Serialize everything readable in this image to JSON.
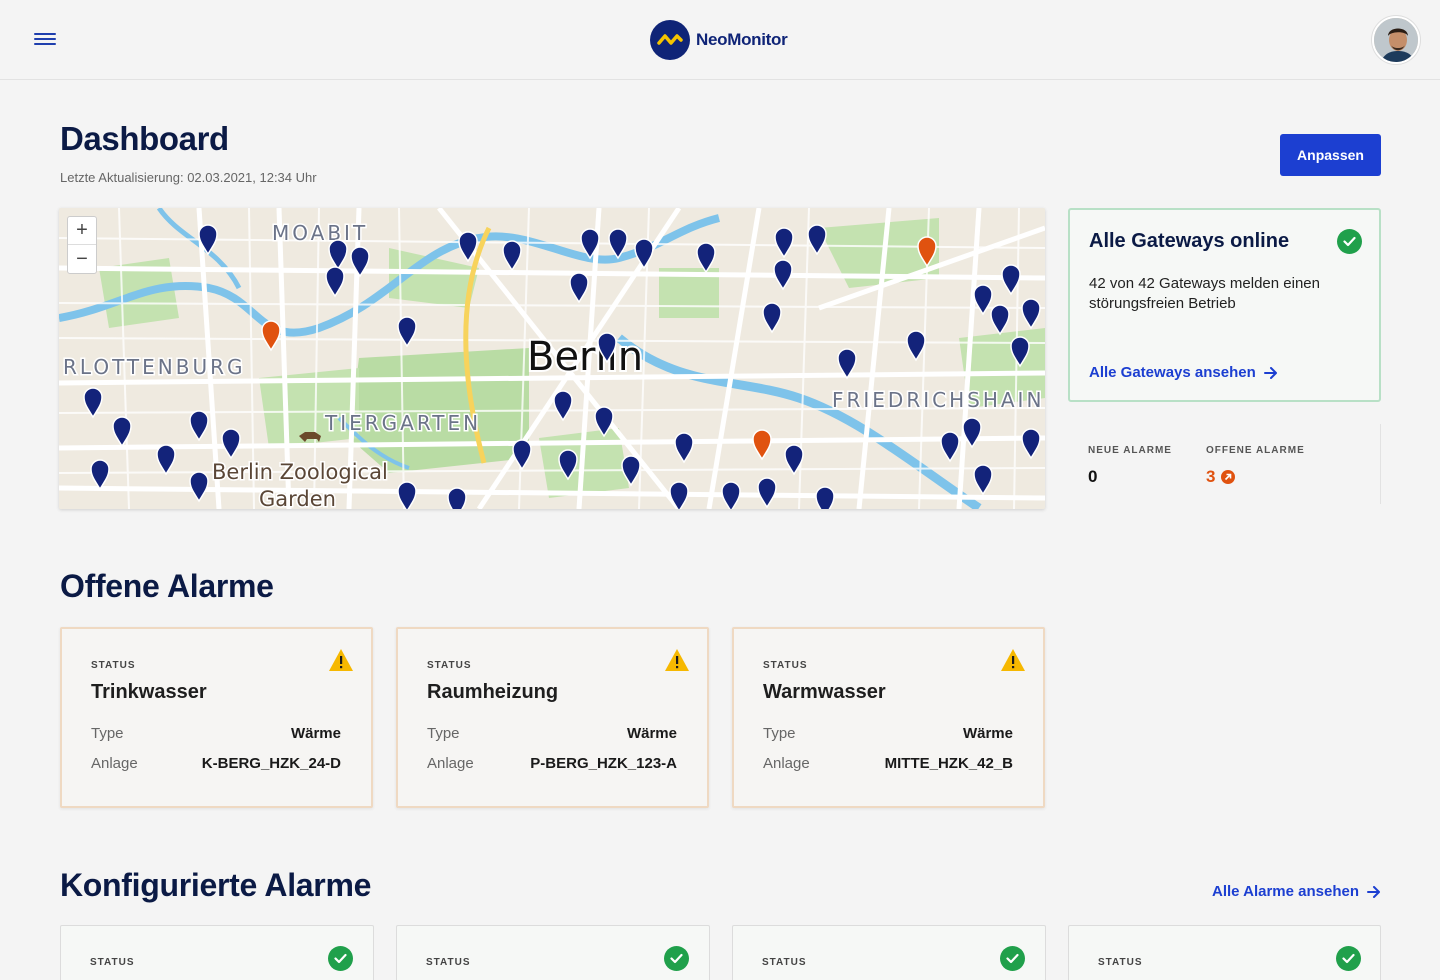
{
  "header": {
    "brand_name": "NeoMonitor",
    "menu_icon": "hamburger-menu-icon",
    "avatar_icon": "user-avatar"
  },
  "page": {
    "title": "Dashboard",
    "updated_label": "Letzte Aktualisierung:",
    "updated_value": "02.03.2021, 12:34 Uhr",
    "customize_button": "Anpassen"
  },
  "map": {
    "labels": {
      "city": "Berlin",
      "moabit": "MOABIT",
      "charlottenburg": "RLOTTENBURG",
      "tiergarten": "TIERGARTEN",
      "friedrichshain": "FRIEDRICHSHAIN",
      "zoo_line1": "Berlin Zoological",
      "zoo_line2": "Garden"
    },
    "zoom_in": "+",
    "zoom_out": "−",
    "colors": {
      "marker_ok": "#13237a",
      "marker_alarm": "#e0520f"
    }
  },
  "gateways": {
    "title": "Alle Gateways online",
    "text": "42 von 42 Gateways melden einen störungsfreien Betrieb",
    "link": "Alle Gateways ansehen",
    "status_color": "#20a04b"
  },
  "stats": {
    "new_label": "NEUE ALARME",
    "new_value": "0",
    "open_label": "OFFENE ALARME",
    "open_value": "3",
    "open_color": "#e0520f"
  },
  "open_alarms": {
    "title": "Offene Alarme",
    "cards": [
      {
        "status_label": "STATUS",
        "name": "Trinkwasser",
        "type_label": "Type",
        "type_value": "Wärme",
        "plant_label": "Anlage",
        "plant_value": "K-BERG_HZK_24-D"
      },
      {
        "status_label": "STATUS",
        "name": "Raumheizung",
        "type_label": "Type",
        "type_value": "Wärme",
        "plant_label": "Anlage",
        "plant_value": "P-BERG_HZK_123-A"
      },
      {
        "status_label": "STATUS",
        "name": "Warmwasser",
        "type_label": "Type",
        "type_value": "Wärme",
        "plant_label": "Anlage",
        "plant_value": "MITTE_HZK_42_B"
      }
    ]
  },
  "configured_alarms": {
    "title": "Konfigurierte Alarme",
    "link": "Alle Alarme ansehen",
    "cards": [
      {
        "status_label": "STATUS"
      },
      {
        "status_label": "STATUS"
      },
      {
        "status_label": "STATUS"
      },
      {
        "status_label": "STATUS"
      }
    ]
  }
}
